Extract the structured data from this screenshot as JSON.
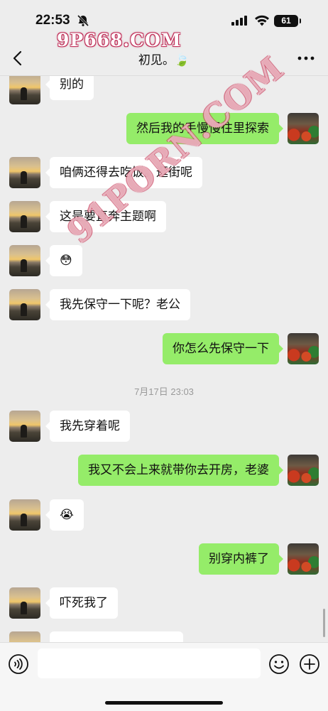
{
  "status_bar": {
    "time": "22:53",
    "battery": "61"
  },
  "watermarks": {
    "top": "9P668.COM",
    "diagonal": "91PORN.COM"
  },
  "nav": {
    "title": "初见。🍃"
  },
  "messages": [
    {
      "side": "left",
      "text": "别的"
    },
    {
      "side": "right",
      "text": "然后我的手慢慢往里探索"
    },
    {
      "side": "left",
      "text": "咱俩还得去吃饭。逛街呢"
    },
    {
      "side": "left",
      "text": "这是要直奔主题啊"
    },
    {
      "side": "left",
      "text": "😳"
    },
    {
      "side": "left",
      "text": "我先保守一下呢？老公"
    },
    {
      "side": "right",
      "text": "你怎么先保守一下"
    },
    {
      "side": "left",
      "text": "我先穿着呢"
    },
    {
      "side": "right",
      "text": "我又不会上来就带你去开房，老婆"
    },
    {
      "side": "left",
      "text": "😭"
    },
    {
      "side": "right",
      "text": "别穿内裤了"
    },
    {
      "side": "left",
      "text": "吓死我了"
    }
  ],
  "timestamp": "7月17日 23:03",
  "input": {
    "value": ""
  },
  "icons": {
    "back": "chevron-left-icon",
    "more": "more-dots-icon",
    "voice": "voice-icon",
    "emoji": "emoji-icon",
    "plus": "plus-icon"
  },
  "colors": {
    "background": "#ededed",
    "bubble_right": "#95ec69",
    "bubble_left": "#ffffff"
  }
}
